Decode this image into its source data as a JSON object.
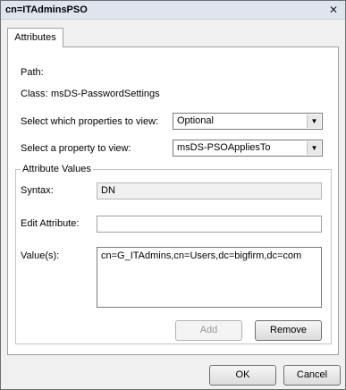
{
  "window": {
    "title": "cn=ITAdminsPSO",
    "close_glyph": "✕"
  },
  "tabs": [
    {
      "label": "Attributes"
    }
  ],
  "info": {
    "path_label": "Path:",
    "class_label": "Class:",
    "class_value": "msDS-PasswordSettings"
  },
  "view_select": {
    "label": "Select which properties to view:",
    "value": "Optional"
  },
  "property_select": {
    "label": "Select a property to view:",
    "value": "msDS-PSOAppliesTo"
  },
  "attribute_values": {
    "group_title": "Attribute Values",
    "syntax_label": "Syntax:",
    "syntax_value": "DN",
    "edit_label": "Edit Attribute:",
    "edit_value": "",
    "values_label": "Value(s):",
    "values": [
      "cn=G_ITAdmins,cn=Users,dc=bigfirm,dc=com"
    ],
    "add_label": "Add",
    "remove_label": "Remove"
  },
  "footer": {
    "ok_label": "OK",
    "cancel_label": "Cancel"
  }
}
